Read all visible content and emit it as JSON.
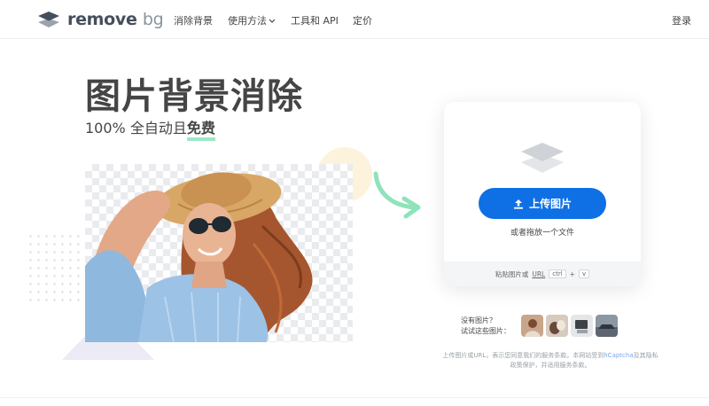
{
  "nav": {
    "logo_main": "remove",
    "logo_suffix": "bg",
    "items": [
      "消除背景",
      "使用方法",
      "工具和 API",
      "定价"
    ],
    "login": "登录"
  },
  "hero": {
    "title": "图片背景消除",
    "subtitle_prefix": "100% 全自动且",
    "subtitle_highlight": "免费"
  },
  "upload": {
    "button_label": "上传图片",
    "drag_text": "或者拖放一个文件",
    "paste_text": "粘贴图片或",
    "url_link": "URL",
    "key_ctrl": "ctrl",
    "key_plus": "+",
    "key_v": "v"
  },
  "samples": {
    "line1": "没有图片？",
    "line2": "试试这些图片："
  },
  "legal": {
    "text1": "上传图片或URL，表示您同意我们的服务条款。本网站受到",
    "link": "hCaptcha",
    "text2": "及其隐私政策保护，并适用服务条款。"
  },
  "colors": {
    "accent_blue": "#0f70e6",
    "highlight_green": "#9de8c4",
    "arrow_green": "#8fe3b9"
  }
}
